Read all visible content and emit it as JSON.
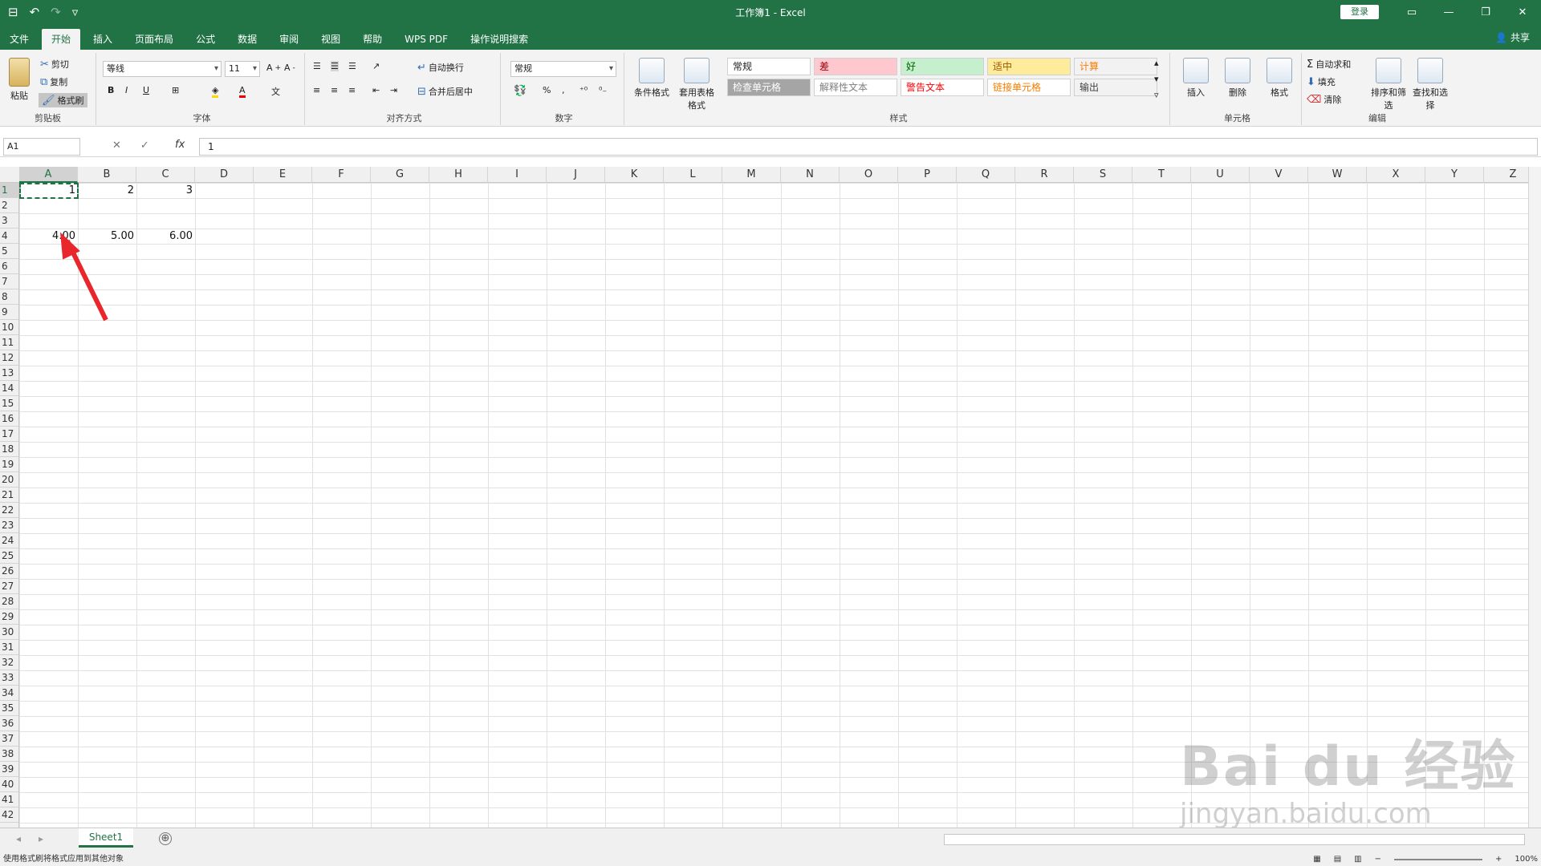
{
  "titlebar": {
    "title": "工作簿1 - Excel",
    "login": "登录",
    "qat_save": "⊟",
    "qat_undo": "↶",
    "qat_redo": "↷",
    "qat_more": "▿",
    "win_ribbon": "▭",
    "win_min": "—",
    "win_restore": "❐",
    "win_close": "✕"
  },
  "tabs": [
    "文件",
    "开始",
    "插入",
    "页面布局",
    "公式",
    "数据",
    "审阅",
    "视图",
    "帮助",
    "WPS PDF",
    "操作说明搜索"
  ],
  "active_tab": "开始",
  "share": "共享",
  "ribbon": {
    "clipboard": {
      "paste": "粘贴",
      "cut": "剪切",
      "copy": "复制",
      "format_painter": "格式刷",
      "label": "剪贴板"
    },
    "font": {
      "name": "等线",
      "size": "11",
      "bold": "B",
      "italic": "I",
      "underline": "U",
      "label": "字体"
    },
    "alignment": {
      "wrap": "自动换行",
      "merge": "合并后居中",
      "label": "对齐方式"
    },
    "number": {
      "format": "常规",
      "percent": "%",
      "label": "数字"
    },
    "styles": {
      "conditional": "条件格式",
      "table": "套用表格格式",
      "cells": [
        {
          "text": "常规",
          "bg": "#ffffff",
          "fg": "#222222"
        },
        {
          "text": "差",
          "bg": "#ffc7ce",
          "fg": "#9c0006"
        },
        {
          "text": "好",
          "bg": "#c6efce",
          "fg": "#006100"
        },
        {
          "text": "适中",
          "bg": "#ffeb9c",
          "fg": "#9c5700"
        },
        {
          "text": "计算",
          "bg": "#f2f2f2",
          "fg": "#fa7d00"
        },
        {
          "text": "检查单元格",
          "bg": "#a5a5a5",
          "fg": "#ffffff"
        },
        {
          "text": "解释性文本",
          "bg": "#ffffff",
          "fg": "#7f7f7f"
        },
        {
          "text": "警告文本",
          "bg": "#ffffff",
          "fg": "#ff0000"
        },
        {
          "text": "链接单元格",
          "bg": "#ffffff",
          "fg": "#fa7d00"
        },
        {
          "text": "输出",
          "bg": "#f2f2f2",
          "fg": "#3f3f3f"
        }
      ],
      "label": "样式"
    },
    "cells_group": {
      "insert": "插入",
      "delete": "删除",
      "format": "格式",
      "label": "单元格"
    },
    "editing": {
      "autosum": "自动求和",
      "fill": "填充",
      "clear": "清除",
      "sort": "排序和筛选",
      "find": "查找和选择",
      "label": "编辑"
    }
  },
  "formula_bar": {
    "name_box": "A1",
    "cancel": "✕",
    "enter": "✓",
    "fx": "fx",
    "content": "1"
  },
  "columns": [
    "A",
    "B",
    "C",
    "D",
    "E",
    "F",
    "G",
    "H",
    "I",
    "J",
    "K",
    "L",
    "M",
    "N",
    "O",
    "P",
    "Q",
    "R",
    "S",
    "T",
    "U",
    "V",
    "W",
    "X",
    "Y",
    "Z"
  ],
  "rows": [
    "1",
    "2",
    "3",
    "4",
    "5",
    "6",
    "7",
    "8",
    "9",
    "10",
    "11",
    "12",
    "13",
    "14",
    "15",
    "16",
    "17",
    "18",
    "19",
    "20",
    "21",
    "22",
    "23",
    "24",
    "25",
    "26",
    "27",
    "28",
    "29",
    "30",
    "31",
    "32",
    "33",
    "34",
    "35",
    "36",
    "37",
    "38",
    "39",
    "40",
    "41",
    "42"
  ],
  "cells": {
    "A1": "1",
    "B1": "2",
    "C1": "3",
    "A4": "4.00",
    "B4": "5.00",
    "C4": "6.00"
  },
  "sheet": {
    "name": "Sheet1",
    "add": "⊕"
  },
  "status": {
    "message": "使用格式刷将格式应用到其他对象",
    "zoom": "100%"
  },
  "watermark": {
    "brand": "Bai du 经验",
    "url": "jingyan.baidu.com"
  }
}
